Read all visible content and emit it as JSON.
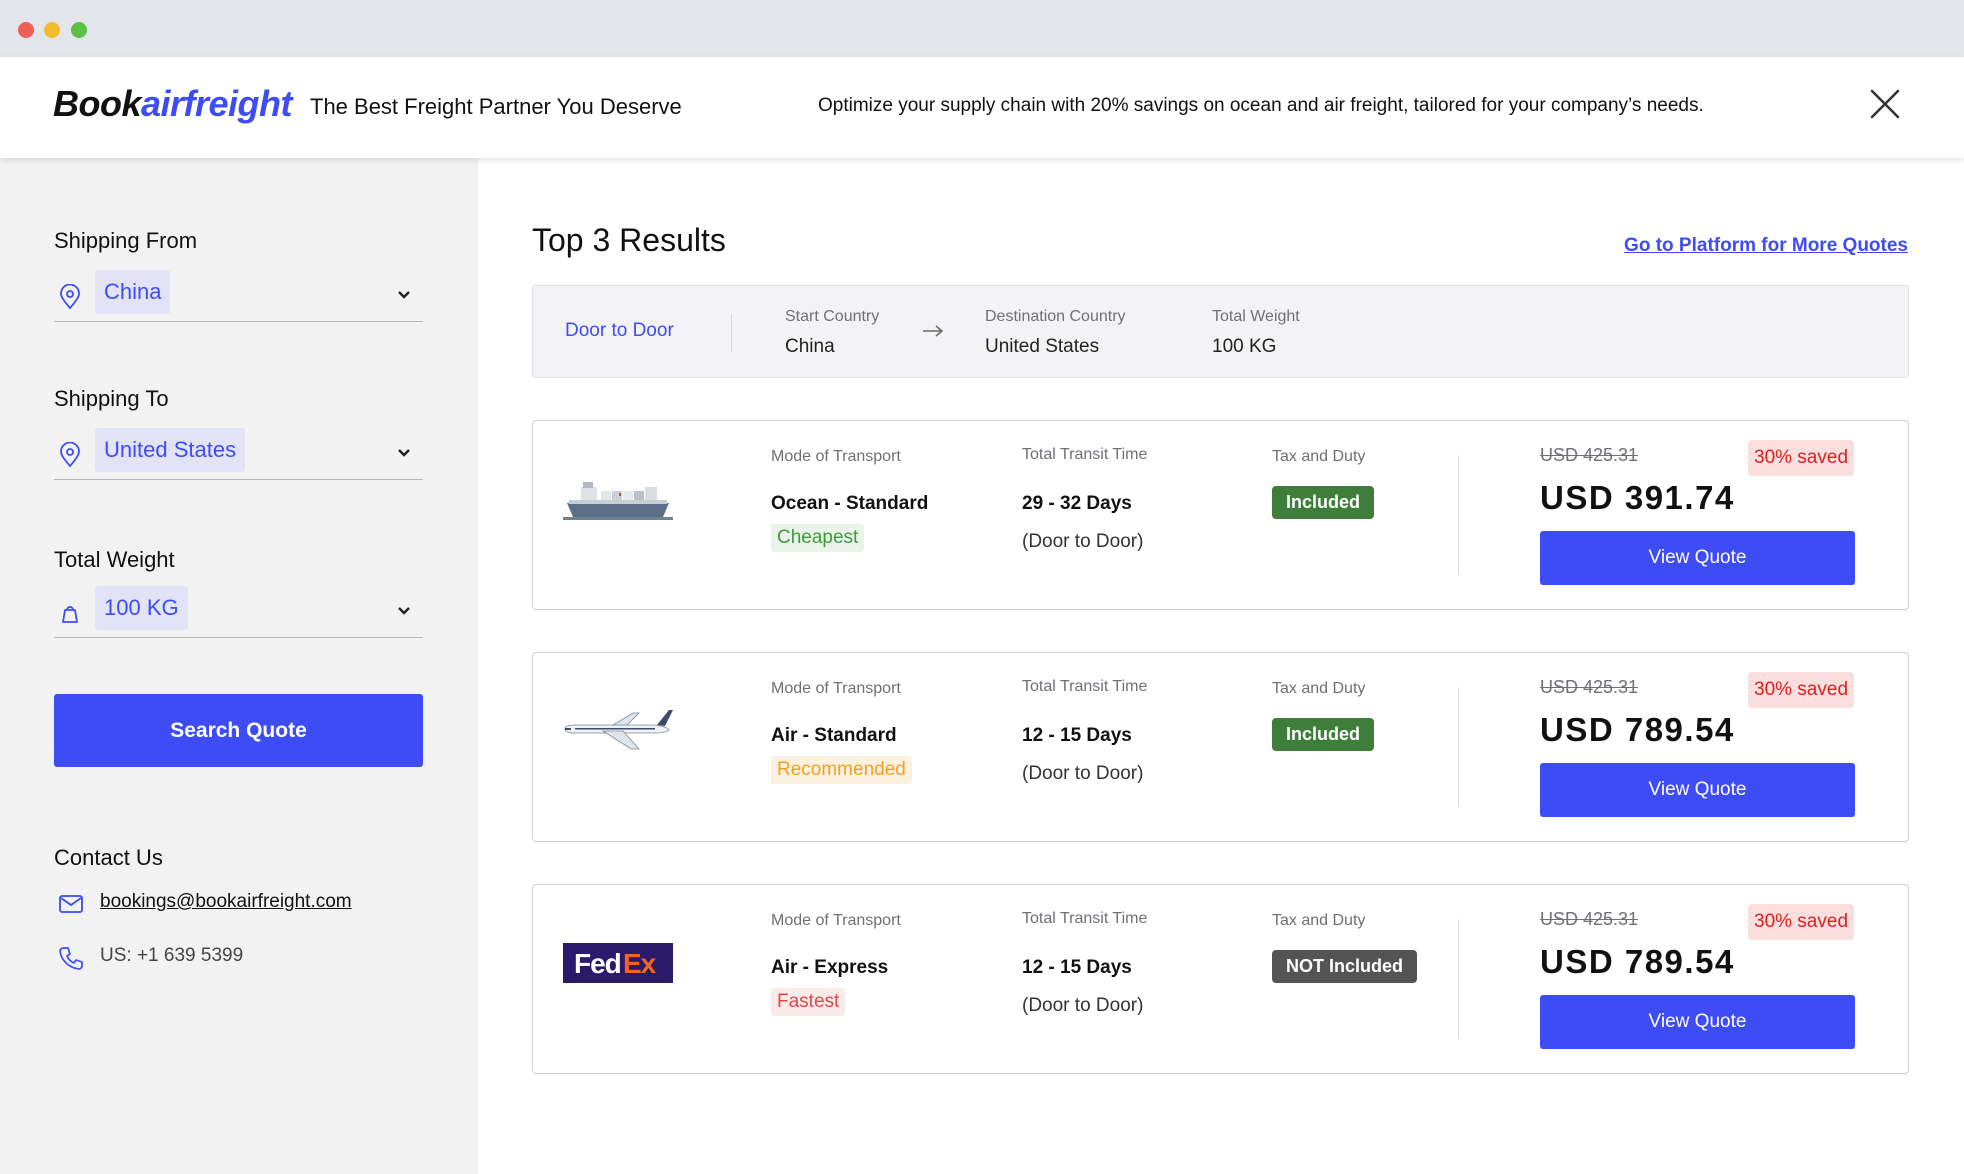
{
  "header": {
    "logo_part1": "Book",
    "logo_part2": "airfreight",
    "tagline": "The Best Freight Partner You Deserve",
    "promo": "Optimize your supply chain with 20% savings on ocean and air freight, tailored for your company’s needs."
  },
  "sidebar": {
    "shipping_from": {
      "label": "Shipping From",
      "value": "China"
    },
    "shipping_to": {
      "label": "Shipping To",
      "value": "United States"
    },
    "total_weight": {
      "label": "Total Weight",
      "value": "100 KG"
    },
    "search_button": "Search Quote",
    "contact": {
      "title": "Contact Us",
      "email": "bookings@bookairfreight.com",
      "phone": "US: +1 639 5399"
    }
  },
  "results": {
    "title": "Top 3 Results",
    "more_link": "Go to Platform for More Quotes",
    "summary": {
      "mode": "Door to Door",
      "start_country_label": "Start Country",
      "start_country": "China",
      "destination_label": "Destination Country",
      "destination": "United States",
      "weight_label": "Total Weight",
      "weight": "100 KG"
    },
    "quotes": [
      {
        "mode_label": "Mode of Transport",
        "mode": "Ocean - Standard",
        "tag": "Cheapest",
        "time_label": "Total Transit Time",
        "time": "29 - 32 Days",
        "time_sub": "(Door to Door)",
        "tax_label": "Tax and Duty",
        "tax": "Included",
        "old_price": "USD 425.31",
        "saved": "30% saved",
        "price": "USD 391.74",
        "button": "View Quote",
        "icon": "ship-icon"
      },
      {
        "mode_label": "Mode of Transport",
        "mode": "Air - Standard",
        "tag": "Recommended",
        "time_label": "Total Transit Time",
        "time": "12 - 15 Days",
        "time_sub": "(Door to Door)",
        "tax_label": "Tax and Duty",
        "tax": "Included",
        "old_price": "USD 425.31",
        "saved": "30% saved",
        "price": "USD 789.54",
        "button": "View Quote",
        "icon": "airplane-icon"
      },
      {
        "mode_label": "Mode of Transport",
        "mode": "Air - Express",
        "tag": "Fastest",
        "time_label": "Total Transit Time",
        "time": "12 - 15 Days",
        "time_sub": "(Door to Door)",
        "tax_label": "Tax and Duty",
        "tax": "NOT Included",
        "old_price": "USD 425.31",
        "saved": "30% saved",
        "price": "USD 789.54",
        "button": "View Quote",
        "icon": "fedex-logo",
        "logo_text": "FedEx"
      }
    ]
  },
  "colors": {
    "accent": "#3e4cf5",
    "included": "#3f7d3a",
    "not_included": "#545454",
    "saved_bg": "#fbdede",
    "saved_text": "#e02020"
  }
}
